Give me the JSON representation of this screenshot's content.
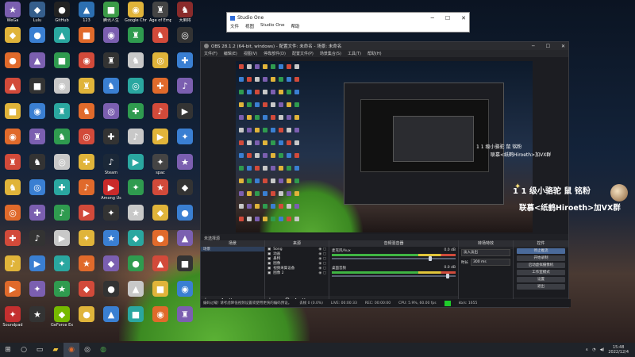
{
  "desktop_icons": [
    {
      "label": "WeGa",
      "icon": "app-icon",
      "color": "#7b5fb0"
    },
    {
      "label": "Lulu",
      "icon": "app-icon",
      "color": "#355e8c"
    },
    {
      "label": "GitHub",
      "icon": "app-icon",
      "color": "#222"
    },
    {
      "label": "123",
      "icon": "app-icon",
      "color": "#2c6fb1"
    },
    {
      "label": "腾讯人生",
      "icon": "app-icon",
      "color": "#3b9b47"
    },
    {
      "label": "Google Chrome",
      "icon": "chrome-icon",
      "color": "#e0b43a"
    },
    {
      "label": "Age of Empires IV",
      "icon": "game-icon",
      "color": "#444"
    },
    {
      "label": "大麻将",
      "icon": "game-icon",
      "color": "#8a2b2b"
    },
    {
      "label": "Steam",
      "icon": "steam-icon",
      "color": "#1b2838"
    },
    {
      "label": "Among Us",
      "icon": "among-us-icon",
      "color": "#c92a2a"
    },
    {
      "label": "Soundpad",
      "icon": "soundpad-icon",
      "color": "#c42f2f"
    },
    {
      "label": "GeForce Experience",
      "icon": "geforce-icon",
      "color": "#76b900"
    },
    {
      "label": "spac",
      "icon": "app-icon",
      "color": "#444"
    }
  ],
  "studio_one": {
    "title": "Studio One",
    "menu": [
      "文件",
      "视图",
      "Studio One",
      "帮助"
    ]
  },
  "obs": {
    "title": "OBS 28.1.2 (64-bit, windows) - 配置文件: 未命名 - 场景: 未命名",
    "menu": [
      "文件(F)",
      "编辑(E)",
      "视图(V)",
      "停靠部件(D)",
      "配置文件(P)",
      "场景集合(S)",
      "工具(T)",
      "帮助(H)"
    ],
    "preview_header": "未选择源",
    "docks": {
      "scenes": {
        "title": "场景",
        "items": [
          "场景"
        ]
      },
      "sources": {
        "title": "来源",
        "items": [
          "Song",
          "动画",
          "鼻特",
          "图像",
          "视频采集设备",
          "图像 2"
        ]
      },
      "mixer": {
        "title": "音频混音器",
        "channels": [
          {
            "name": "麦克风/Aux",
            "db": "0.0 dB",
            "level": 0.78
          },
          {
            "name": "桌面音频",
            "db": "0.0 dB",
            "level": 0.92
          }
        ]
      },
      "transitions": {
        "title": "转场特效",
        "type": "淡入淡出",
        "duration_label": "时长",
        "duration": "300 ms"
      },
      "controls": {
        "title": "控件",
        "buttons": [
          "停止推流",
          "开始录制",
          "启动虚拟摄像机",
          "工作室模式",
          "设置",
          "退出"
        ]
      }
    },
    "statusbar": {
      "message": "编码过载! 请考虑降低视频设置或使用更快的编码预设。",
      "dropped": "丢帧 0 (0.0%)",
      "live": "LIVE: 00:00:33",
      "rec": "REC: 00:00:00",
      "cpu": "CPU: 5.9%, 60.00 fps",
      "kbps": "kb/s: 1655"
    }
  },
  "overlay": {
    "small1": "1 1 级小骆驼 鼠 铭粉",
    "small2": "联慕<纸鹤Hiroeth>加VX群",
    "line1": "1 1 级小骆驼 鼠 铭粉",
    "line2": "联慕<纸鹤Hiroeth>加VX群"
  },
  "taskbar": {
    "time": "15:48",
    "date": "2022/12/4",
    "apps": [
      "start",
      "search",
      "task-view",
      "file-explorer",
      "browser",
      "obs",
      "chrome"
    ]
  }
}
